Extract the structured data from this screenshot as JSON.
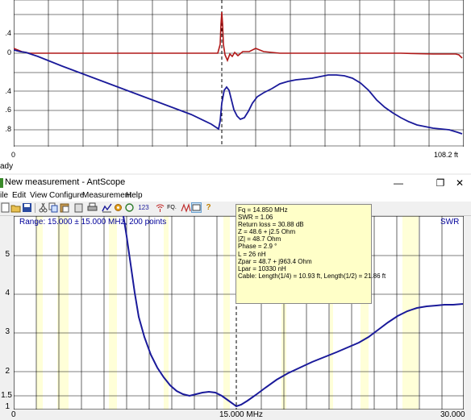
{
  "tdr": {
    "y_ticks": [
      ".4",
      "0",
      ".4",
      ".6",
      ".8"
    ],
    "x_min": "0",
    "x_max": "108.2 ft",
    "status": "ady",
    "colors": {
      "curve_red": "#b01818",
      "curve_blue": "#1a1a9a"
    }
  },
  "window": {
    "title": "New measurement - AntScope",
    "minimize": "—",
    "restore": "❐",
    "close": "✕"
  },
  "menu": [
    "ile",
    "Edit",
    "View",
    "Configure",
    "Measurement",
    "Help"
  ],
  "toolbar": {
    "icons": [
      "new-icon",
      "open-icon",
      "save-icon",
      "copy-icon",
      "cut-icon",
      "paste-icon",
      "clipboard-icon",
      "print-icon",
      "chart-icon",
      "settings-icon",
      "refresh-icon",
      "numbers-icon",
      "antenna-icon",
      "frequency-icon",
      "marker-icon",
      "active-icon",
      "help-icon"
    ],
    "numbers_label": "123",
    "fq_label": "FQ."
  },
  "swr": {
    "range_text": "Range: 15.000 ± 15.000 MHz, 200 points",
    "tag": "SWR",
    "y_ticks": [
      "5",
      "4",
      "3",
      "2",
      "1.5",
      "1"
    ],
    "x_labels": [
      "0",
      "15.000 MHz",
      "30.000"
    ],
    "colors": {
      "curve": "#1a1a9a",
      "band": "#ffffd8"
    }
  },
  "tooltip": {
    "lines": [
      "Fq = 14.850 MHz",
      "SWR = 1.06",
      "Return loss = 30.88 dB",
      "Z = 48.6 + j2.5 Ohm",
      "|Z| = 48.7 Ohm",
      "Phase = 2.9 °",
      "L = 26 nH",
      "Zpar = 48.7 + j963.4 Ohm",
      "Lpar = 10330 nH",
      "Cable: Length(1/4) = 10.93 ft, Length(1/2) = 21.86 ft"
    ]
  }
}
